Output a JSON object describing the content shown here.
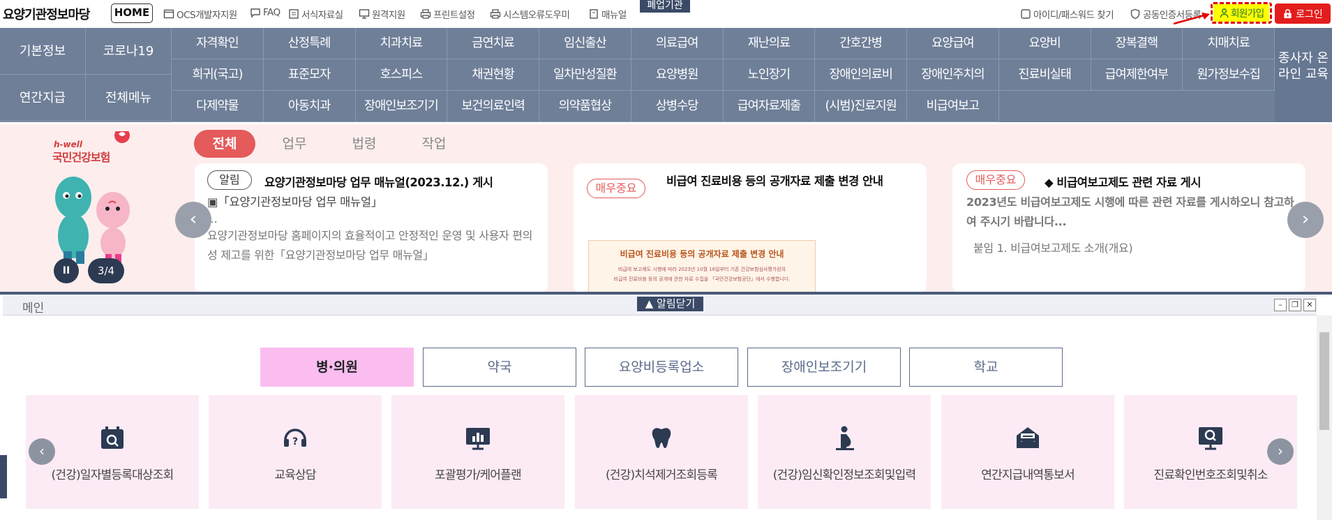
{
  "header": {
    "site_title": "요양기관정보마당",
    "home_label": "HOME",
    "utility_links": [
      "OCS개발자지원",
      "FAQ",
      "서식자료실",
      "원격지원",
      "프린트설정",
      "시스템오류도우미",
      "매뉴얼"
    ],
    "closed_badge": "폐업기관",
    "right_links": [
      "아이디/패스워드 찾기",
      "공동인증서등록"
    ],
    "signup_label": "회원가입",
    "login_label": "로그인",
    "highlight_color": "#ffff00",
    "accent_red": "#e31d1d"
  },
  "nav": {
    "left": [
      "기본정보",
      "코로나19",
      "연간지급",
      "전체메뉴"
    ],
    "row1": [
      "자격확인",
      "산정특례",
      "치과치료",
      "금연치료",
      "임신출산",
      "의료급여",
      "재난의료",
      "간호간병",
      "요양급여",
      "요양비",
      "장복결핵",
      "치매치료"
    ],
    "row2": [
      "희귀(국고)",
      "표준모자",
      "호스피스",
      "채권현황",
      "일차만성질환",
      "요양병원",
      "노인장기",
      "장애인의료비",
      "장애인주치의",
      "진료비실태",
      "급여제한여부",
      "원가정보수집"
    ],
    "row3": [
      "다제약물",
      "아동치과",
      "장애인보조기기",
      "보건의료인력",
      "의약품협상",
      "상병수당",
      "급여자료제출",
      "(시범)진료지원",
      "비급여보고"
    ],
    "right": "종사자 온라인 교육",
    "bg_color": "#6f7f98"
  },
  "notice": {
    "brand_small": "h-well",
    "brand": "국민건강보험",
    "page_indicator": "3/4",
    "pause_label": "II",
    "tabs": [
      "전체",
      "업무",
      "법령",
      "작업"
    ],
    "cards": [
      {
        "badge": "알림",
        "title": "요양기관정보마당 업무 매뉴얼(2023.12.) 게시",
        "line1": "▣「요양기관정보마당 업무 매뉴얼」",
        "line2": "...",
        "line3": "요양기관정보마당 홈페이지의 효율적이고 안정적인 운영 및 사용자 편의성 제고를 위한「요양기관정보마당 업무 매뉴얼」"
      },
      {
        "badge": "매우중요",
        "title": "비급여 진료비용 등의 공개자료 제출 변경 안내",
        "thumb_title": "비급여 진료비용 등의 공개자료 제출 변경 안내",
        "thumb_line1": "비급여 보고제도 시행에 따라 2023년 10월 16일부터 기존 건강보험심사평가원의",
        "thumb_line2": "비급여 진료비용 등의 공개에 관한 자료 수집을 「국민건강보험공단」에서 수행합니다."
      },
      {
        "badge": "매우중요",
        "title": "◆ 비급여보고제도 관련 자료 게시",
        "line1": "2023년도 비급여보고제도 시행에 따른 관련 자료를 게시하오니 참고하여 주시기 바랍니다...",
        "line2": "붙임 1. 비급여보고제도 소개(개요)"
      }
    ]
  },
  "main": {
    "window_title": "메인",
    "close_notice_label": "▲ 알림닫기",
    "category_tabs": [
      "병·의원",
      "약국",
      "요양비등록업소",
      "장애인보조기기",
      "학교"
    ],
    "active_tab_color": "#fbbdf0",
    "services": [
      {
        "label": "(건강)일자별등록대상조회",
        "icon": "calendar-search-icon"
      },
      {
        "label": "교육상담",
        "icon": "headset-icon"
      },
      {
        "label": "포괄평가/케어플랜",
        "icon": "presentation-chart-icon"
      },
      {
        "label": "(건강)치석제거조회등록",
        "icon": "tooth-icon"
      },
      {
        "label": "(건강)임신확인정보조회및입력",
        "icon": "pregnancy-icon"
      },
      {
        "label": "연간지급내역통보서",
        "icon": "envelope-icon"
      },
      {
        "label": "진료확인번호조회및취소",
        "icon": "monitor-search-icon"
      }
    ]
  }
}
